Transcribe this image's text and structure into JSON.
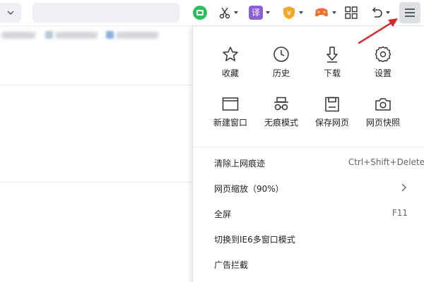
{
  "toolbar": {
    "search": {
      "value": "",
      "placeholder": ""
    },
    "icons": [
      "search-icon",
      "wechat-icon",
      "scissors-icon",
      "translate-icon",
      "shield-icon",
      "game-icon",
      "grid-icon",
      "undo-icon",
      "menu-icon"
    ],
    "translate_glyph": "译",
    "accent_colors": {
      "wechat": "#2dbd5a",
      "translate": "#8b5fd6",
      "shield": "#f5a623",
      "game": "#f06a35"
    }
  },
  "menu": {
    "grid": [
      {
        "label": "收藏",
        "icon": "star-icon"
      },
      {
        "label": "历史",
        "icon": "clock-icon"
      },
      {
        "label": "下载",
        "icon": "download-icon"
      },
      {
        "label": "设置",
        "icon": "gear-icon"
      },
      {
        "label": "新建窗口",
        "icon": "window-icon"
      },
      {
        "label": "无痕模式",
        "icon": "incognito-icon"
      },
      {
        "label": "保存网页",
        "icon": "save-icon"
      },
      {
        "label": "网页快照",
        "icon": "camera-icon"
      }
    ],
    "list": [
      {
        "label": "清除上网痕迹",
        "shortcut": "Ctrl+Shift+Delete"
      },
      {
        "label": "网页缩放（90%）",
        "shortcut": ""
      },
      {
        "label": "全屏",
        "shortcut": "F11"
      },
      {
        "label": "切换到IE6多窗口模式",
        "shortcut": ""
      },
      {
        "label": "广告拦截",
        "shortcut": ""
      }
    ]
  },
  "annotation": {
    "arrow_color": "#d9262b"
  }
}
